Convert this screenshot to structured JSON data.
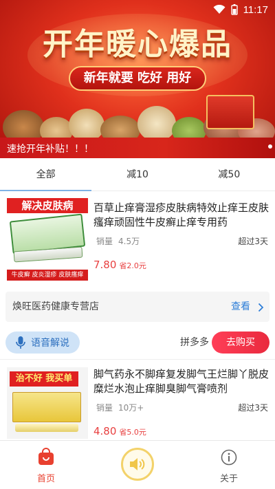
{
  "status_bar": {
    "time": "11:17"
  },
  "banner": {
    "title": "开年暖心爆品",
    "subtitle": "新年就要 吃好 用好",
    "caption": "速抢开年补贴！！！"
  },
  "tabs": [
    {
      "label": "全部",
      "active": true
    },
    {
      "label": "减10",
      "active": false
    },
    {
      "label": "减50",
      "active": false
    }
  ],
  "products": [
    {
      "title": "百草止痒膏湿疹皮肤病特效止痒王皮肤瘙痒顽固性牛皮癣止痒专用药",
      "sales_label": "销量",
      "sales_value": "4.5万",
      "shipping": "超过3天",
      "price": "7.80",
      "saving": "省2.0元",
      "image_banner": "解决皮肤病",
      "image_footer": "牛皮癣 皮炎湿疹 皮肤瘙痒"
    },
    {
      "title": "脚气药永不脚痒复发脚气王烂脚丫脱皮糜烂水泡止痒脚臭脚气膏喷剂",
      "sales_label": "销量",
      "sales_value": "10万+",
      "shipping": "超过3天",
      "price": "4.80",
      "saving": "省5.0元",
      "image_banner": "治不好 我买单"
    }
  ],
  "store": {
    "name": "焕旺医药健康专营店",
    "view_label": "查看"
  },
  "actions": {
    "voice_label": "语音解说",
    "platform": "拼多多",
    "buy_label": "去购买"
  },
  "bottom_nav": {
    "home_label": "首页",
    "about_label": "关于"
  },
  "colors": {
    "accent_red": "#e8402f",
    "link_blue": "#2d7ed8",
    "tab_underline": "#7fb2e5"
  }
}
